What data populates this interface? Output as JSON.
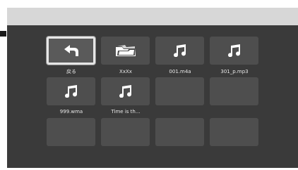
{
  "media_grid": {
    "items": [
      {
        "label": "戻る",
        "icon": "back-arrow-icon",
        "selected": true
      },
      {
        "label": "XxXx",
        "icon": "folder-icon",
        "selected": false
      },
      {
        "label": "001.m4a",
        "icon": "music-note-icon",
        "selected": false
      },
      {
        "label": "301_p.mp3",
        "icon": "music-note-icon",
        "selected": false
      },
      {
        "label": "999.wma",
        "icon": "music-note-icon",
        "selected": false
      },
      {
        "label": "Time is th...",
        "icon": "music-note-icon",
        "selected": false
      },
      {
        "label": "",
        "icon": "",
        "selected": false
      },
      {
        "label": "",
        "icon": "",
        "selected": false
      },
      {
        "label": "",
        "icon": "",
        "selected": false
      },
      {
        "label": "",
        "icon": "",
        "selected": false
      },
      {
        "label": "",
        "icon": "",
        "selected": false
      },
      {
        "label": "",
        "icon": "",
        "selected": false
      }
    ]
  },
  "colors": {
    "screen_background": "#3a3a3a",
    "title_bar": "#d7d7d7",
    "tile": "#4e4e4e",
    "selection_border": "#e6e6e6",
    "icon": "#ffffff"
  }
}
